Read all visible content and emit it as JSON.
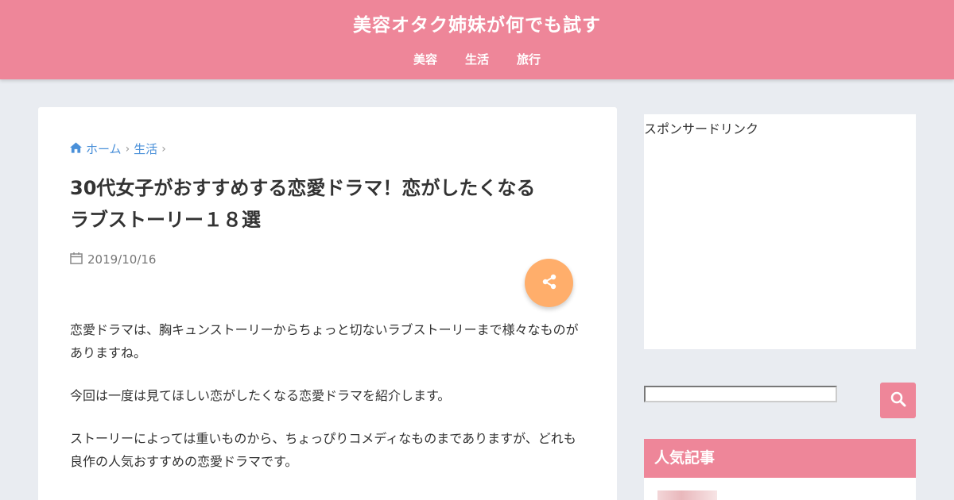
{
  "site": {
    "title": "美容オタク姉妹が何でも試す"
  },
  "nav": {
    "items": [
      {
        "label": "美容"
      },
      {
        "label": "生活"
      },
      {
        "label": "旅行"
      }
    ]
  },
  "breadcrumb": {
    "home": "ホーム",
    "category": "生活"
  },
  "article": {
    "title_line1": "30代女子がおすすめする恋愛ドラマ！恋がしたくなる",
    "title_line2": "ラブストーリー１８選",
    "date": "2019/10/16",
    "paragraphs": [
      "恋愛ドラマは、胸キュンストーリーからちょっと切ないラブストーリーまで様々なものがありますね。",
      "今回は一度は見てほしい恋がしたくなる恋愛ドラマを紹介します。",
      "ストーリーによっては重いものから、ちょっぴりコメディなものまでありますが、どれも良作の人気おすすめの恋愛ドラマです。"
    ]
  },
  "sidebar": {
    "ad_label": "スポンサードリンク",
    "search": {
      "value": "",
      "placeholder": ""
    },
    "popular_title": "人気記事"
  },
  "colors": {
    "brand": "#ee8699",
    "share": "#ffae6b",
    "link": "#4a90d9",
    "background": "#e9ecf1"
  },
  "icons": {
    "home": "home-icon",
    "calendar": "calendar-icon",
    "share": "share-icon",
    "search": "search-icon"
  }
}
